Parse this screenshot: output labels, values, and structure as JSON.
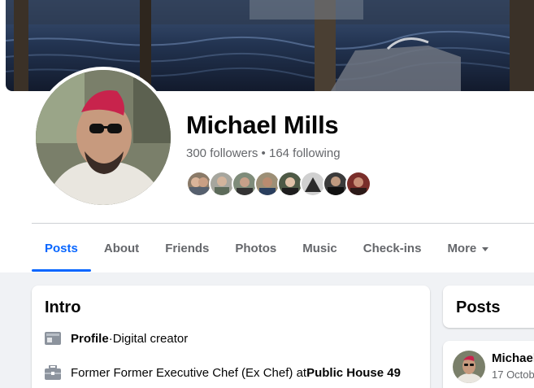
{
  "profile": {
    "name": "Michael Mills",
    "followers": "300 followers",
    "separator": " • ",
    "following": "164 following"
  },
  "tabs": [
    {
      "label": "Posts",
      "active": true
    },
    {
      "label": "About"
    },
    {
      "label": "Friends"
    },
    {
      "label": "Photos"
    },
    {
      "label": "Music"
    },
    {
      "label": "Check-ins"
    },
    {
      "label": "More"
    }
  ],
  "intro": {
    "title": "Intro",
    "profile_label": "Profile",
    "profile_sep": " · ",
    "profile_type": "Digital creator",
    "work_prefix": "Former Former Executive Chef (Ex Chef) at ",
    "work_place": "Public House 49"
  },
  "posts_panel": {
    "title": "Posts",
    "post_author": "Michael",
    "post_date": "17 Octob"
  },
  "colors": {
    "accent": "#0866ff",
    "secondary_text": "#65676b",
    "background": "#f0f2f5"
  },
  "icons": {
    "more_caret": "chevron-down-icon",
    "profile": "id-card-icon",
    "work": "briefcase-icon"
  }
}
